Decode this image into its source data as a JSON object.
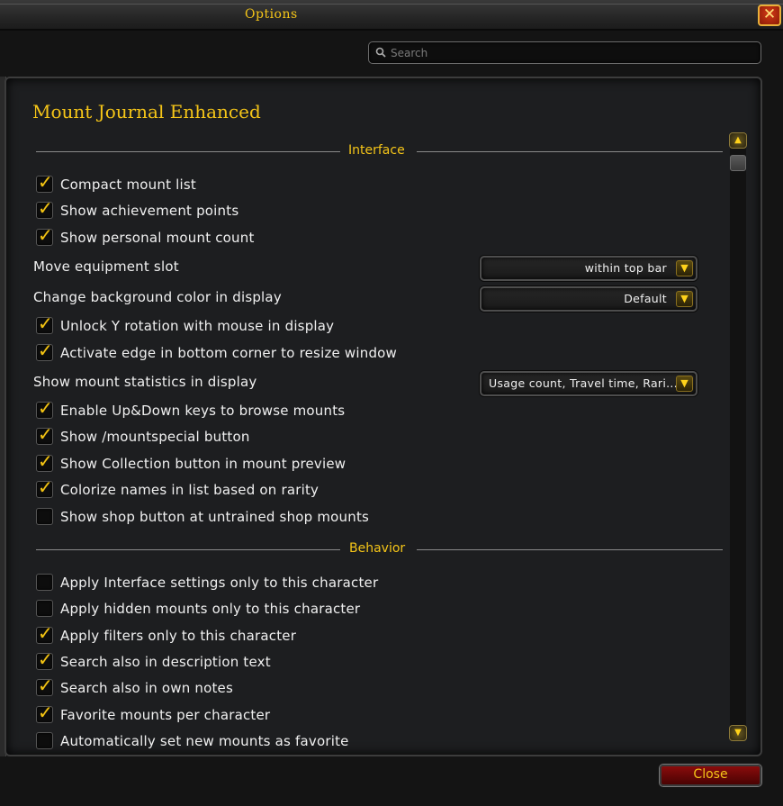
{
  "window": {
    "title": "Options",
    "close_icon": "close-x-icon"
  },
  "search": {
    "placeholder": "Search"
  },
  "panel": {
    "title": "Mount Journal Enhanced"
  },
  "sections": {
    "interface": "Interface",
    "behavior": "Behavior"
  },
  "interface": {
    "compact_mount_list": {
      "label": "Compact mount list",
      "checked": true
    },
    "show_achievement_points": {
      "label": "Show achievement points",
      "checked": true
    },
    "show_personal_mount_count": {
      "label": "Show personal mount count",
      "checked": true
    },
    "move_equipment_slot": {
      "label": "Move equipment slot",
      "value": "within top bar"
    },
    "change_bg_color": {
      "label": "Change background color in display",
      "value": "Default"
    },
    "unlock_y_rotation": {
      "label": "Unlock Y rotation with mouse in display",
      "checked": true
    },
    "activate_edge": {
      "label": "Activate edge in bottom corner to resize window",
      "checked": true
    },
    "show_mount_statistics": {
      "label": "Show mount statistics in display",
      "value": "Usage count, Travel time, Rari..."
    },
    "enable_updown": {
      "label": "Enable Up&Down keys to browse mounts",
      "checked": true
    },
    "show_mountspecial": {
      "label": "Show /mountspecial button",
      "checked": true
    },
    "show_collection_button": {
      "label": "Show Collection button in mount preview",
      "checked": true
    },
    "colorize_names": {
      "label": "Colorize names in list based on rarity",
      "checked": true
    },
    "show_shop_button": {
      "label": "Show shop button at untrained shop mounts",
      "checked": false
    }
  },
  "behavior": {
    "apply_interface_settings": {
      "label": "Apply Interface settings only to this character",
      "checked": false
    },
    "apply_hidden_mounts": {
      "label": "Apply hidden mounts only to this character",
      "checked": false
    },
    "apply_filters": {
      "label": "Apply filters only to this character",
      "checked": true
    },
    "search_description": {
      "label": "Search also in description text",
      "checked": true
    },
    "search_notes": {
      "label": "Search also in own notes",
      "checked": true
    },
    "favorite_per_character": {
      "label": "Favorite mounts per character",
      "checked": true
    },
    "auto_favorite": {
      "label": "Automatically set new mounts as favorite",
      "checked": false
    }
  },
  "footer": {
    "close_label": "Close"
  },
  "colors": {
    "accent_gold": "#f5c518",
    "close_red": "#8a0c0c"
  }
}
